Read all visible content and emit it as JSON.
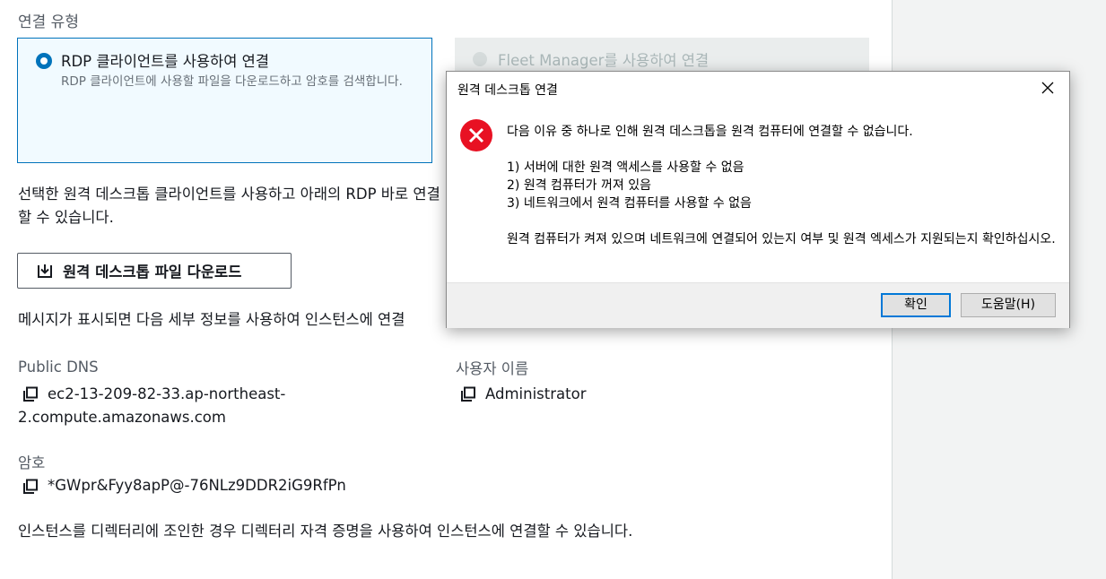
{
  "connection": {
    "section_title": "연결 유형",
    "rdp_option": {
      "label": "RDP 클라이언트를 사용하여 연결",
      "description": "RDP 클라이언트에 사용할 파일을 다운로드하고 암호를 검색합니다.",
      "selected": true
    },
    "fleet_option": {
      "label": "Fleet Manager를 사용하여 연결",
      "selected": false
    }
  },
  "body": {
    "intro_text": "선택한 원격 데스크톱 클라이언트를 사용하고 아래의 RDP 바로 연결할 수 있습니다.",
    "download_button": "원격 데스크톱 파일 다운로드",
    "message_text": "메시지가 표시되면 다음 세부 정보를 사용하여 인스턴스에 연결",
    "public_dns_label": "Public DNS",
    "public_dns_value": "ec2-13-209-82-33.ap-northeast-2.compute.amazonaws.com",
    "username_label": "사용자 이름",
    "username_value": "Administrator",
    "password_label": "암호",
    "password_value": "*GWpr&Fyy8apP@-76NLz9DDR2iG9RfPn",
    "footer_text": "인스턴스를 디렉터리에 조인한 경우 디렉터리 자격 증명을 사용하여 인스턴스에 연결할 수 있습니다."
  },
  "dialog": {
    "title": "원격 데스크톱 연결",
    "main_message": "다음 이유 중 하나로 인해 원격 데스크톱을 원격 컴퓨터에 연결할 수 없습니다.",
    "reasons": [
      "1) 서버에 대한 원격 액세스를 사용할 수 없음",
      "2) 원격 컴퓨터가 꺼져 있음",
      "3) 네트워크에서 원격 컴퓨터를 사용할 수 없음"
    ],
    "advice": "원격 컴퓨터가 켜져 있으며 네트워크에 연결되어 있는지 여부 및 원격 엑세스가 지원되는지 확인하십시오.",
    "ok_button": "확인",
    "help_button": "도움말(H)",
    "icon": "error-icon"
  },
  "colors": {
    "accent": "#0073bb",
    "error_red": "#e81123",
    "dialog_focus": "#0078d7"
  }
}
